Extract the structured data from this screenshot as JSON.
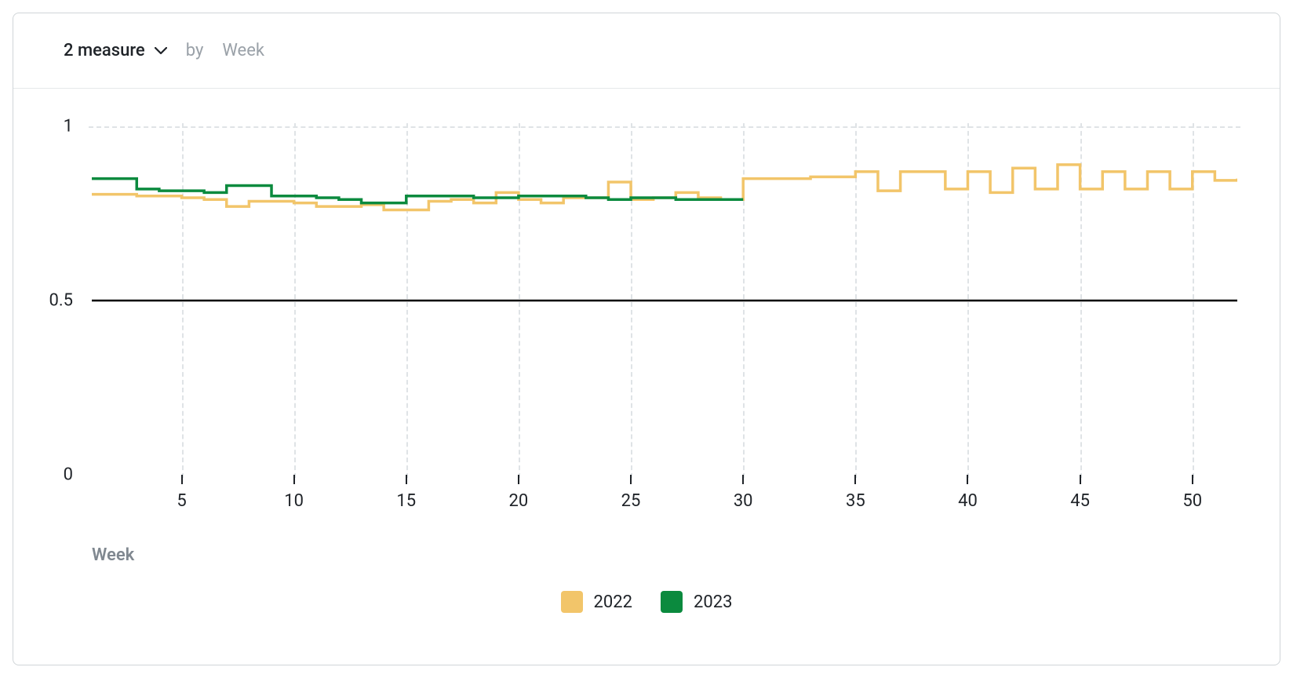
{
  "header": {
    "measure_label": "2 measure",
    "by_label": "by",
    "dimension_label": "Week"
  },
  "chart_data": {
    "type": "line",
    "step": "hv",
    "xlabel": "Week",
    "ylabel": "",
    "xlim": [
      1,
      52
    ],
    "ylim": [
      0,
      1
    ],
    "x_ticks": [
      5,
      10,
      15,
      20,
      25,
      30,
      35,
      40,
      45,
      50
    ],
    "y_ticks": [
      0,
      0.5,
      1
    ],
    "reference_lines": [
      {
        "y": 0.5,
        "color": "#000000"
      }
    ],
    "legend_position": "bottom-center",
    "x": [
      1,
      2,
      3,
      4,
      5,
      6,
      7,
      8,
      9,
      10,
      11,
      12,
      13,
      14,
      15,
      16,
      17,
      18,
      19,
      20,
      21,
      22,
      23,
      24,
      25,
      26,
      27,
      28,
      29,
      30,
      31,
      32,
      33,
      34,
      35,
      36,
      37,
      38,
      39,
      40,
      41,
      42,
      43,
      44,
      45,
      46,
      47,
      48,
      49,
      50,
      51,
      52
    ],
    "series": [
      {
        "name": "2022",
        "color": "#f2c56a",
        "values": [
          0.805,
          0.805,
          0.8,
          0.8,
          0.795,
          0.79,
          0.77,
          0.785,
          0.785,
          0.78,
          0.77,
          0.77,
          0.775,
          0.76,
          0.76,
          0.785,
          0.79,
          0.78,
          0.81,
          0.79,
          0.78,
          0.795,
          0.795,
          0.84,
          0.79,
          0.795,
          0.81,
          0.795,
          0.79,
          0.85,
          0.85,
          0.85,
          0.855,
          0.855,
          0.87,
          0.815,
          0.87,
          0.87,
          0.82,
          0.87,
          0.81,
          0.88,
          0.82,
          0.89,
          0.82,
          0.87,
          0.82,
          0.87,
          0.82,
          0.87,
          0.845,
          0.85
        ]
      },
      {
        "name": "2023",
        "color": "#0b8a3e",
        "values": [
          0.85,
          0.85,
          0.82,
          0.815,
          0.815,
          0.81,
          0.83,
          0.83,
          0.8,
          0.8,
          0.795,
          0.79,
          0.78,
          0.78,
          0.8,
          0.8,
          0.8,
          0.795,
          0.795,
          0.8,
          0.8,
          0.8,
          0.795,
          0.79,
          0.795,
          0.795,
          0.79,
          0.79,
          0.79
        ]
      }
    ]
  },
  "legend": {
    "items": [
      {
        "label": "2022",
        "color_class": "sw-2022"
      },
      {
        "label": "2023",
        "color_class": "sw-2023"
      }
    ]
  }
}
